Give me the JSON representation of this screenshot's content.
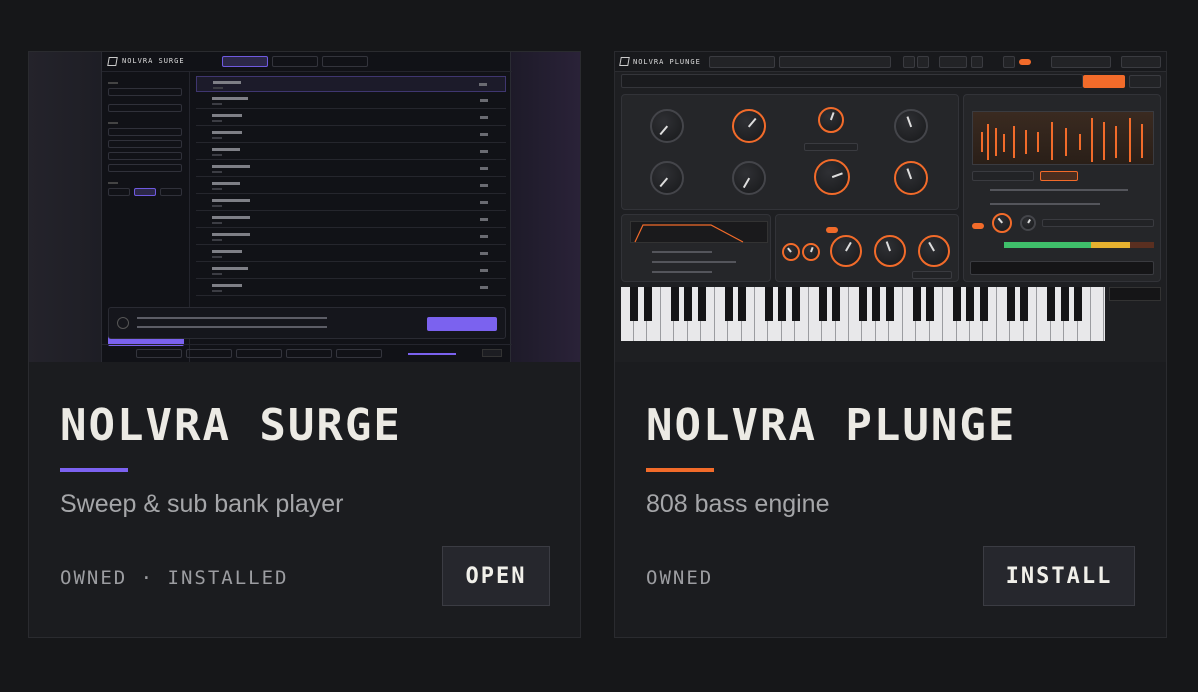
{
  "cards": [
    {
      "id": "surge",
      "title": "NOLVRA SURGE",
      "subtitle": "Sweep & sub bank player",
      "status": "OWNED · INSTALLED",
      "button_label": "OPEN",
      "accent": "#7c62f0",
      "thumbnail": {
        "brand": "NOLVRA SURGE"
      }
    },
    {
      "id": "plunge",
      "title": "NOLVRA PLUNGE",
      "subtitle": "808 bass engine",
      "status": "OWNED",
      "button_label": "INSTALL",
      "accent": "#f26b2a",
      "thumbnail": {
        "brand": "NOLVRA PLUNGE"
      }
    }
  ],
  "colors": {
    "background": "#161719",
    "card": "#1b1c1f",
    "button": "#26272d"
  }
}
